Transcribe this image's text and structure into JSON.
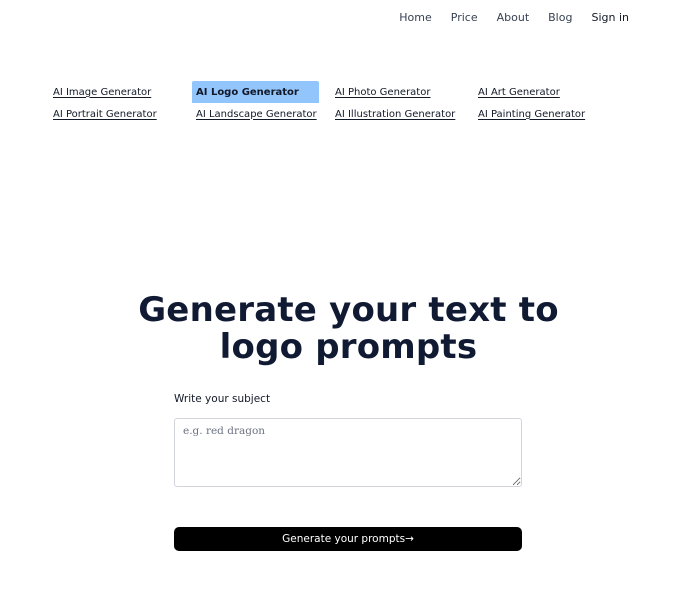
{
  "nav": {
    "items": [
      {
        "label": "Home"
      },
      {
        "label": "Price"
      },
      {
        "label": "About"
      },
      {
        "label": "Blog"
      },
      {
        "label": "Sign in"
      }
    ]
  },
  "generators": {
    "active_index": 1,
    "items": [
      {
        "label": "AI Image Generator"
      },
      {
        "label": "AI Logo Generator"
      },
      {
        "label": "AI Photo Generator"
      },
      {
        "label": "AI Art Generator"
      },
      {
        "label": "AI Portrait Generator"
      },
      {
        "label": "AI Landscape Generator"
      },
      {
        "label": "AI Illustration Generator"
      },
      {
        "label": "AI Painting Generator"
      }
    ],
    "active_color": "#93c5fd"
  },
  "hero": {
    "title_line1": "Generate your text to",
    "title_line2": "logo prompts"
  },
  "form": {
    "subject_label": "Write your subject",
    "subject_value": "",
    "subject_placeholder": "e.g. red dragon",
    "submit_label": "Generate your prompts→"
  }
}
